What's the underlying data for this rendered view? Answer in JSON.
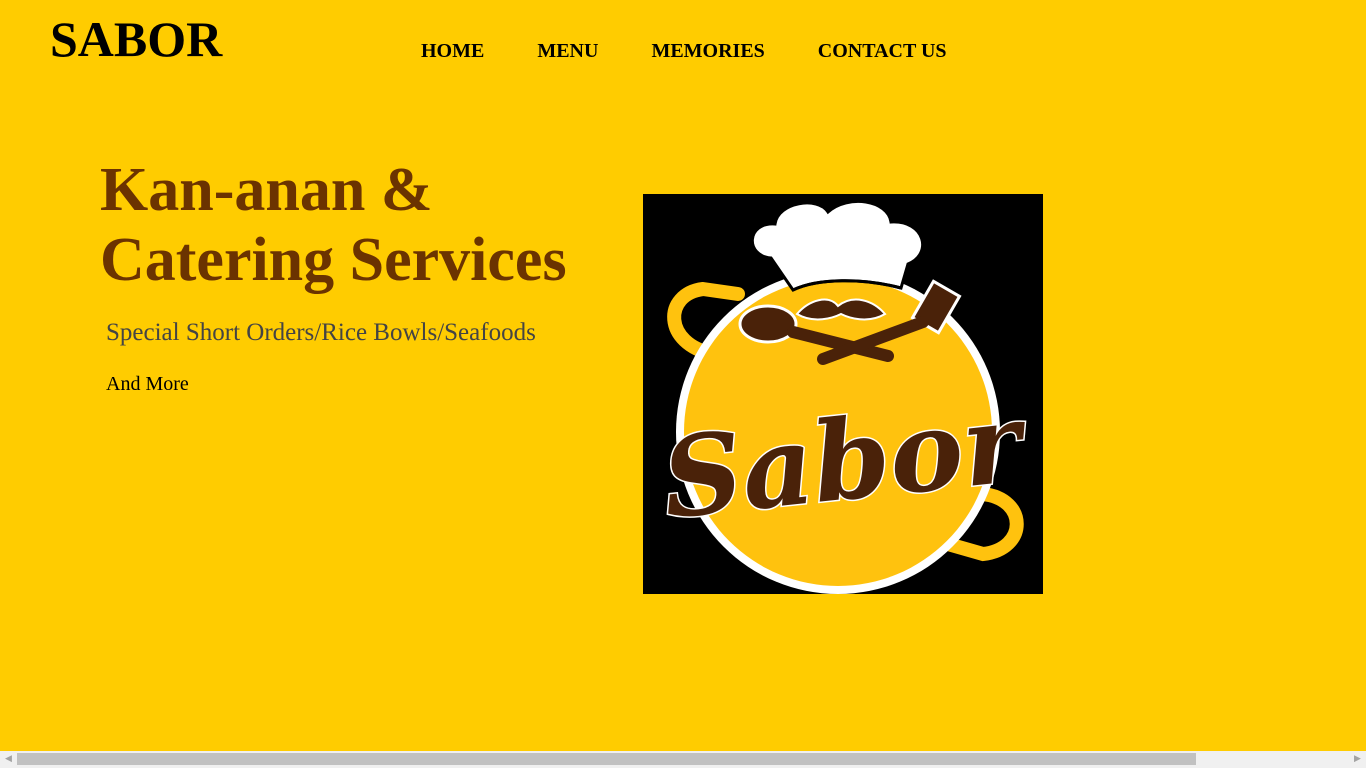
{
  "brand": "SABOR",
  "nav": {
    "home": "HOME",
    "menu": "MENU",
    "memories": "MEMORIES",
    "contact": "CONTACT US"
  },
  "hero": {
    "title_line1": "Kan-anan &",
    "title_line2": "Catering Services",
    "subtitle": "Special Short Orders/Rice Bowls/Seafoods",
    "more": "And More"
  },
  "logo": {
    "text": "Sabor",
    "icons": [
      "chef-hat-icon",
      "mustache-icon",
      "spoon-icon",
      "spatula-icon",
      "pan-icon"
    ]
  },
  "colors": {
    "background": "#ffcc00",
    "headline": "#6b3300",
    "logo_brown": "#4a2209",
    "logo_yellow": "#ffc20e"
  },
  "scrollbar": {
    "left_arrow": "◀",
    "right_arrow": "▶"
  }
}
